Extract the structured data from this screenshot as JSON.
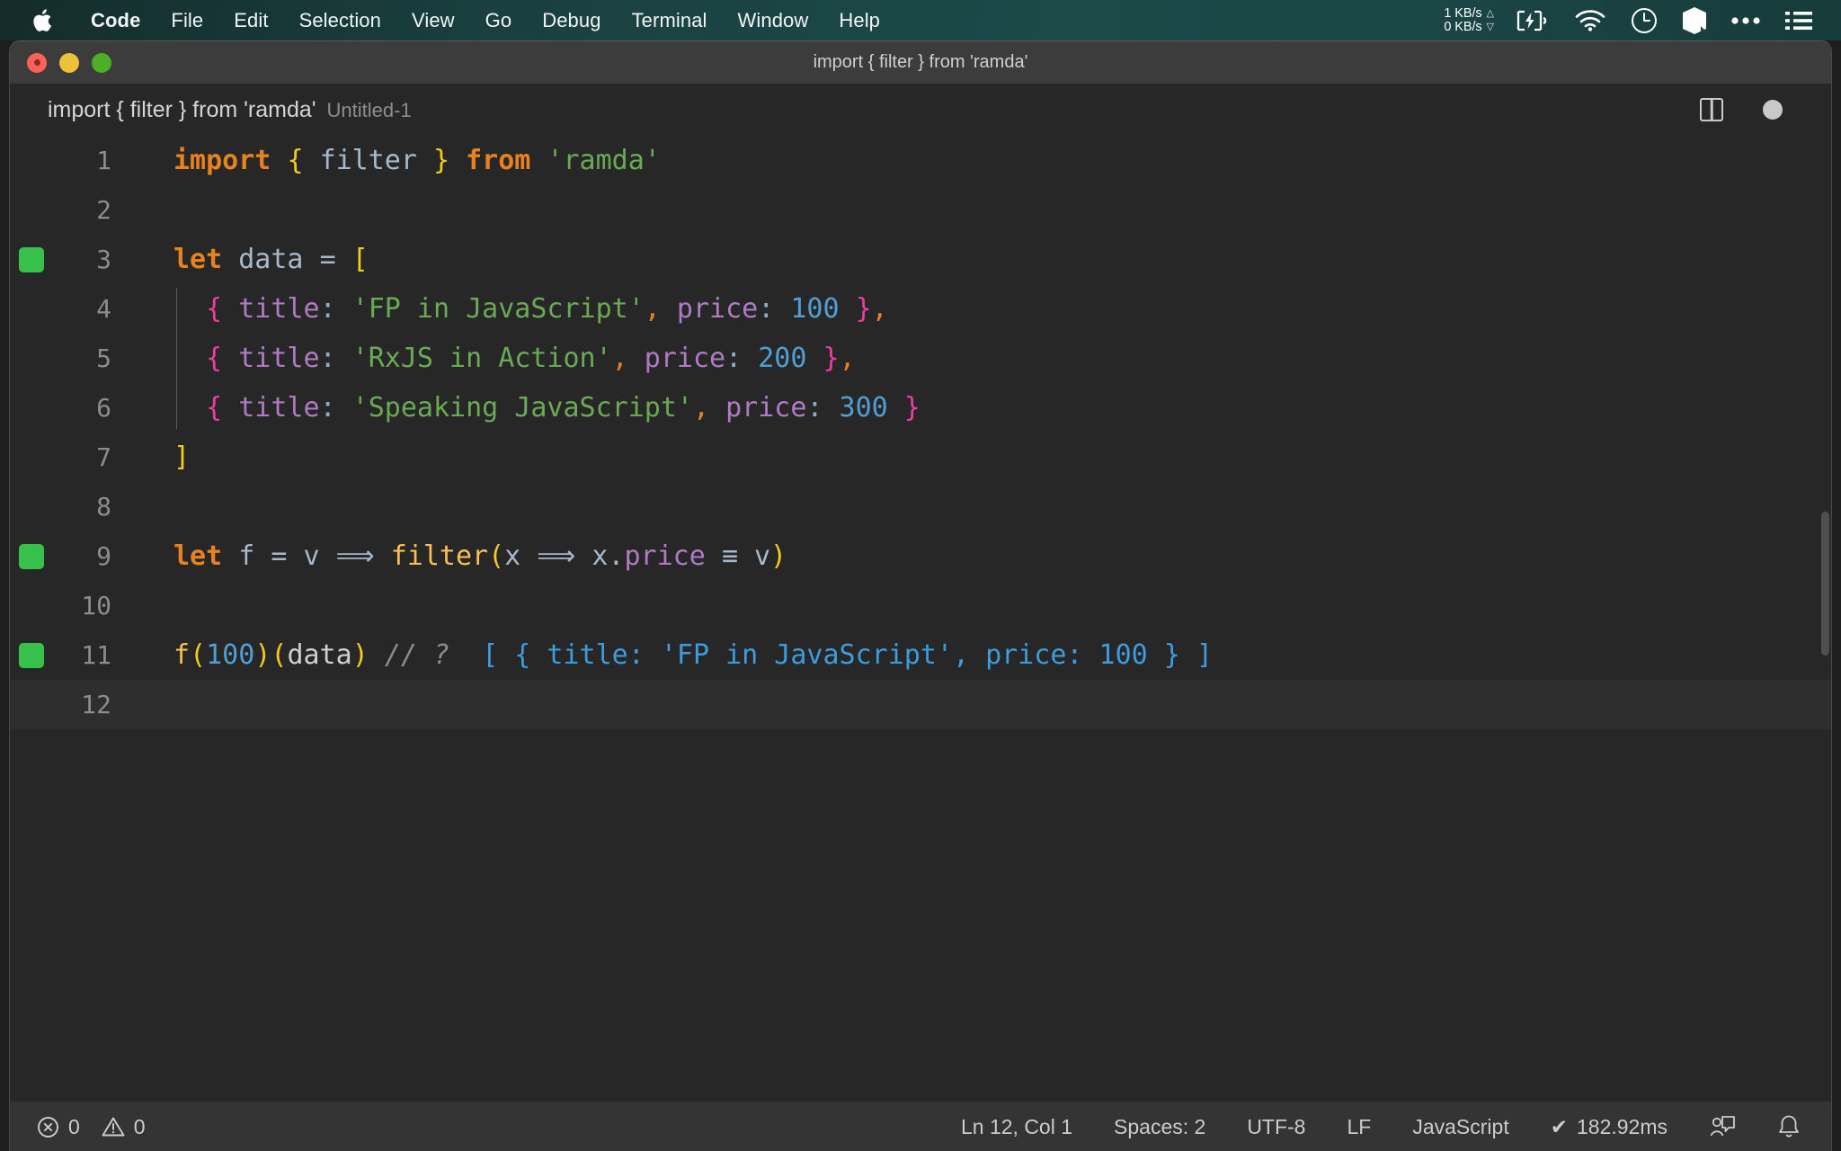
{
  "menubar": {
    "apple_icon": "apple-logo-icon",
    "items": [
      {
        "label": "Code",
        "bold": true
      },
      {
        "label": "File",
        "bold": false
      },
      {
        "label": "Edit",
        "bold": false
      },
      {
        "label": "Selection",
        "bold": false
      },
      {
        "label": "View",
        "bold": false
      },
      {
        "label": "Go",
        "bold": false
      },
      {
        "label": "Debug",
        "bold": false
      },
      {
        "label": "Terminal",
        "bold": false
      },
      {
        "label": "Window",
        "bold": false
      },
      {
        "label": "Help",
        "bold": false
      }
    ],
    "network": {
      "upload": "1 KB/s",
      "download": "0 KB/s",
      "up_arrow": "△",
      "down_arrow": "▽"
    },
    "status_icons": [
      "battery-charging-icon",
      "wifi-icon",
      "clock-icon",
      "cube-icon",
      "ellipsis-icon",
      "control-center-list-icon"
    ]
  },
  "window": {
    "title": "import { filter } from 'ramda'",
    "traffic_lights": [
      "close-button",
      "minimize-button",
      "maximize-button"
    ]
  },
  "breadcrumb": {
    "primary": "import { filter } from 'ramda'",
    "secondary": "Untitled-1"
  },
  "editor_actions": {
    "split_editor": "split-editor-icon",
    "unsaved_indicator": "unsaved-dot-icon"
  },
  "editor": {
    "current_line": 12,
    "lines": [
      {
        "num": "1",
        "marker": false,
        "tokens": [
          {
            "t": "import",
            "c": "t-kw"
          },
          {
            "t": " ",
            "c": "t-var"
          },
          {
            "t": "{",
            "c": "t-brace-y"
          },
          {
            "t": " ",
            "c": "t-var"
          },
          {
            "t": "filter",
            "c": "t-var"
          },
          {
            "t": " ",
            "c": "t-var"
          },
          {
            "t": "}",
            "c": "t-brace-y"
          },
          {
            "t": " ",
            "c": "t-var"
          },
          {
            "t": "from",
            "c": "t-kw"
          },
          {
            "t": " ",
            "c": "t-var"
          },
          {
            "t": "'ramda'",
            "c": "t-str"
          }
        ]
      },
      {
        "num": "2",
        "marker": false,
        "tokens": []
      },
      {
        "num": "3",
        "marker": true,
        "tokens": [
          {
            "t": "let",
            "c": "t-kw"
          },
          {
            "t": " ",
            "c": "t-var"
          },
          {
            "t": "data",
            "c": "t-var"
          },
          {
            "t": " ",
            "c": "t-var"
          },
          {
            "t": "=",
            "c": "t-op"
          },
          {
            "t": " ",
            "c": "t-var"
          },
          {
            "t": "[",
            "c": "t-brace-y"
          }
        ]
      },
      {
        "num": "4",
        "marker": false,
        "tokens": [
          {
            "t": "  ",
            "c": "t-var"
          },
          {
            "t": "{",
            "c": "t-brace-p"
          },
          {
            "t": " ",
            "c": "t-var"
          },
          {
            "t": "title",
            "c": "t-prop"
          },
          {
            "t": ":",
            "c": "t-colon"
          },
          {
            "t": " ",
            "c": "t-var"
          },
          {
            "t": "'FP in JavaScript'",
            "c": "t-str"
          },
          {
            "t": ",",
            "c": "t-comma-o"
          },
          {
            "t": " ",
            "c": "t-var"
          },
          {
            "t": "price",
            "c": "t-prop"
          },
          {
            "t": ":",
            "c": "t-colon"
          },
          {
            "t": " ",
            "c": "t-var"
          },
          {
            "t": "100",
            "c": "t-num"
          },
          {
            "t": " ",
            "c": "t-var"
          },
          {
            "t": "}",
            "c": "t-brace-p"
          },
          {
            "t": ",",
            "c": "t-comma-o"
          }
        ]
      },
      {
        "num": "5",
        "marker": false,
        "tokens": [
          {
            "t": "  ",
            "c": "t-var"
          },
          {
            "t": "{",
            "c": "t-brace-p"
          },
          {
            "t": " ",
            "c": "t-var"
          },
          {
            "t": "title",
            "c": "t-prop"
          },
          {
            "t": ":",
            "c": "t-colon"
          },
          {
            "t": " ",
            "c": "t-var"
          },
          {
            "t": "'RxJS in Action'",
            "c": "t-str"
          },
          {
            "t": ",",
            "c": "t-comma-o"
          },
          {
            "t": " ",
            "c": "t-var"
          },
          {
            "t": "price",
            "c": "t-prop"
          },
          {
            "t": ":",
            "c": "t-colon"
          },
          {
            "t": " ",
            "c": "t-var"
          },
          {
            "t": "200",
            "c": "t-num"
          },
          {
            "t": " ",
            "c": "t-var"
          },
          {
            "t": "}",
            "c": "t-brace-p"
          },
          {
            "t": ",",
            "c": "t-comma-o"
          }
        ]
      },
      {
        "num": "6",
        "marker": false,
        "tokens": [
          {
            "t": "  ",
            "c": "t-var"
          },
          {
            "t": "{",
            "c": "t-brace-p"
          },
          {
            "t": " ",
            "c": "t-var"
          },
          {
            "t": "title",
            "c": "t-prop"
          },
          {
            "t": ":",
            "c": "t-colon"
          },
          {
            "t": " ",
            "c": "t-var"
          },
          {
            "t": "'Speaking JavaScript'",
            "c": "t-str"
          },
          {
            "t": ",",
            "c": "t-comma-o"
          },
          {
            "t": " ",
            "c": "t-var"
          },
          {
            "t": "price",
            "c": "t-prop"
          },
          {
            "t": ":",
            "c": "t-colon"
          },
          {
            "t": " ",
            "c": "t-var"
          },
          {
            "t": "300",
            "c": "t-num"
          },
          {
            "t": " ",
            "c": "t-var"
          },
          {
            "t": "}",
            "c": "t-brace-p"
          }
        ]
      },
      {
        "num": "7",
        "marker": false,
        "tokens": [
          {
            "t": "]",
            "c": "t-brace-y"
          }
        ]
      },
      {
        "num": "8",
        "marker": false,
        "tokens": []
      },
      {
        "num": "9",
        "marker": true,
        "tokens": [
          {
            "t": "let",
            "c": "t-kw"
          },
          {
            "t": " ",
            "c": "t-var"
          },
          {
            "t": "f",
            "c": "t-var"
          },
          {
            "t": " ",
            "c": "t-var"
          },
          {
            "t": "=",
            "c": "t-op"
          },
          {
            "t": " ",
            "c": "t-var"
          },
          {
            "t": "v",
            "c": "t-var"
          },
          {
            "t": " ",
            "c": "t-var"
          },
          {
            "t": "⟹",
            "c": "lig-arrow"
          },
          {
            "t": " ",
            "c": "t-var"
          },
          {
            "t": "filter",
            "c": "t-func"
          },
          {
            "t": "(",
            "c": "t-brace-y"
          },
          {
            "t": "x",
            "c": "t-var"
          },
          {
            "t": " ",
            "c": "t-var"
          },
          {
            "t": "⟹",
            "c": "lig-arrow"
          },
          {
            "t": " ",
            "c": "t-var"
          },
          {
            "t": "x.",
            "c": "t-var"
          },
          {
            "t": "price",
            "c": "t-prop"
          },
          {
            "t": " ",
            "c": "t-var"
          },
          {
            "t": "≡",
            "c": "lig-eq"
          },
          {
            "t": " ",
            "c": "t-var"
          },
          {
            "t": "v",
            "c": "t-var"
          },
          {
            "t": ")",
            "c": "t-brace-y"
          }
        ]
      },
      {
        "num": "10",
        "marker": false,
        "tokens": []
      },
      {
        "num": "11",
        "marker": true,
        "tokens": [
          {
            "t": "f",
            "c": "t-func"
          },
          {
            "t": "(",
            "c": "t-brace-y"
          },
          {
            "t": "100",
            "c": "t-num"
          },
          {
            "t": ")",
            "c": "t-brace-y"
          },
          {
            "t": "(",
            "c": "t-brace-y"
          },
          {
            "t": "data",
            "c": "t-ident"
          },
          {
            "t": ")",
            "c": "t-brace-y"
          },
          {
            "t": " ",
            "c": "t-var"
          },
          {
            "t": "// ?",
            "c": "t-comment"
          },
          {
            "t": "  ",
            "c": "t-var"
          },
          {
            "t": "[ { title: 'FP in JavaScript', price: 100 } ]",
            "c": "t-result"
          }
        ]
      },
      {
        "num": "12",
        "marker": false,
        "tokens": []
      }
    ]
  },
  "statusbar": {
    "errors": "0",
    "warnings": "0",
    "error_icon": "error-circle-icon",
    "warning_icon": "warning-triangle-icon",
    "cursor_position": "Ln 12, Col 1",
    "indentation": "Spaces: 2",
    "encoding": "UTF-8",
    "eol": "LF",
    "language": "JavaScript",
    "quokka_result": "182.92ms",
    "quokka_check": "✔",
    "feedback_icon": "feedback-person-icon",
    "bell_icon": "notification-bell-icon"
  },
  "colors": {
    "menubar_accent": "#1b4a49",
    "window_chrome": "#3c3c3c",
    "editor_bg": "#272727",
    "statusbar_bg": "#343434",
    "quokka_marker_green": "#38c14a",
    "result_blue": "#3c9cdd"
  }
}
